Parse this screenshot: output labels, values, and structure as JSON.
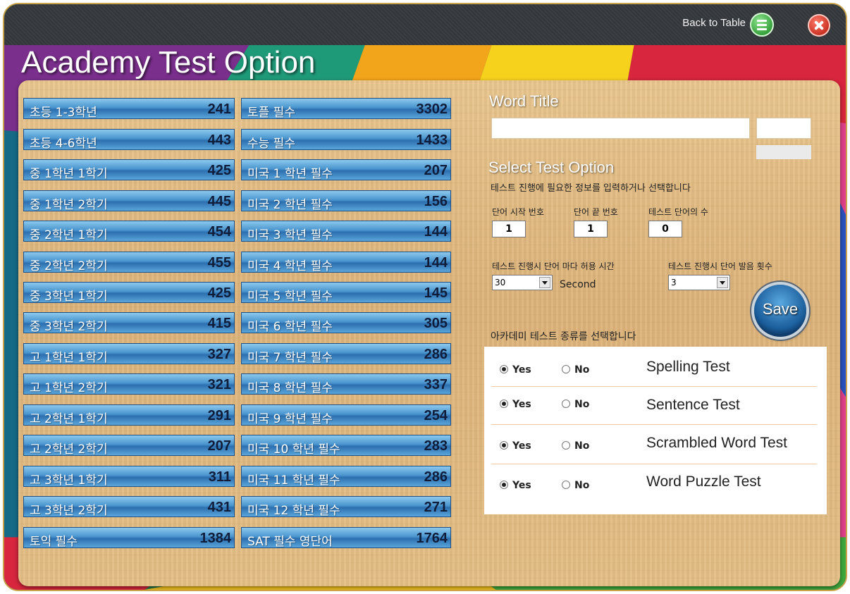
{
  "window": {
    "title": "Academy Test Option",
    "back_label": "Back to Table"
  },
  "icons": {
    "back": "list-icon",
    "close": "close-icon"
  },
  "colors": {
    "accent": "#2d6fb0",
    "close": "#c52c1e",
    "back": "#2f9a35"
  },
  "word_lists": [
    {
      "label": "초등 1-3학년",
      "count": "241"
    },
    {
      "label": "초등 4-6학년",
      "count": "443"
    },
    {
      "label": "중 1학년 1학기",
      "count": "425"
    },
    {
      "label": "중 1학년 2학기",
      "count": "445"
    },
    {
      "label": "중 2학년 1학기",
      "count": "454"
    },
    {
      "label": "중 2학년 2학기",
      "count": "455"
    },
    {
      "label": "중 3학년 1학기",
      "count": "425"
    },
    {
      "label": "중 3학년 2학기",
      "count": "415"
    },
    {
      "label": "고 1학년 1학기",
      "count": "327"
    },
    {
      "label": "고 1학년 2학기",
      "count": "321"
    },
    {
      "label": "고 2학년 1학기",
      "count": "291"
    },
    {
      "label": "고 2학년 2학기",
      "count": "207"
    },
    {
      "label": "고 3학년 1학기",
      "count": "311"
    },
    {
      "label": "고 3학년 2학기",
      "count": "431"
    },
    {
      "label": "토익 필수",
      "count": "1384"
    },
    {
      "label": "토플 필수",
      "count": "3302"
    },
    {
      "label": "수능 필수",
      "count": "1433"
    },
    {
      "label": "미국 1 학년 필수",
      "count": "207"
    },
    {
      "label": "미국 2 학년 필수",
      "count": "156"
    },
    {
      "label": "미국 3 학년 필수",
      "count": "144"
    },
    {
      "label": "미국 4 학년 필수",
      "count": "144"
    },
    {
      "label": "미국 5 학년 필수",
      "count": "145"
    },
    {
      "label": "미국 6 학년 필수",
      "count": "305"
    },
    {
      "label": "미국 7 학년 필수",
      "count": "286"
    },
    {
      "label": "미국 8 학년 필수",
      "count": "337"
    },
    {
      "label": "미국 9 학년 필수",
      "count": "254"
    },
    {
      "label": "미국 10 학년 필수",
      "count": "283"
    },
    {
      "label": "미국 11 학년 필수",
      "count": "286"
    },
    {
      "label": "미국 12 학년 필수",
      "count": "271"
    },
    {
      "label": "SAT 필수 영단어",
      "count": "1764"
    }
  ],
  "word_title": {
    "heading": "Word Title",
    "value": "",
    "side_value": ""
  },
  "test_option": {
    "heading": "Select Test Option",
    "description": "테스트 진행에 필요한 정보를 입력하거나 선택합니다",
    "start_label": "단어 시작 번호",
    "start_value": "1",
    "end_label": "단어 끝 번호",
    "end_value": "1",
    "count_label": "테스트 단어의 수",
    "count_value": "0",
    "time_label": "테스트 진행시 단어 마다 허용 시간",
    "time_value": "30",
    "time_unit": "Second",
    "repeat_label": "테스트 진행시 단어 발음 횟수",
    "repeat_value": "3",
    "save_label": "Save"
  },
  "test_types": {
    "heading": "아카데미 테스트 종류를 선택합니다",
    "yes_label": "Yes",
    "no_label": "No",
    "items": [
      {
        "name": "Spelling Test",
        "selected": "yes"
      },
      {
        "name": "Sentence Test",
        "selected": "yes"
      },
      {
        "name": "Scrambled Word Test",
        "selected": "yes"
      },
      {
        "name": "Word Puzzle Test",
        "selected": "yes"
      }
    ]
  }
}
